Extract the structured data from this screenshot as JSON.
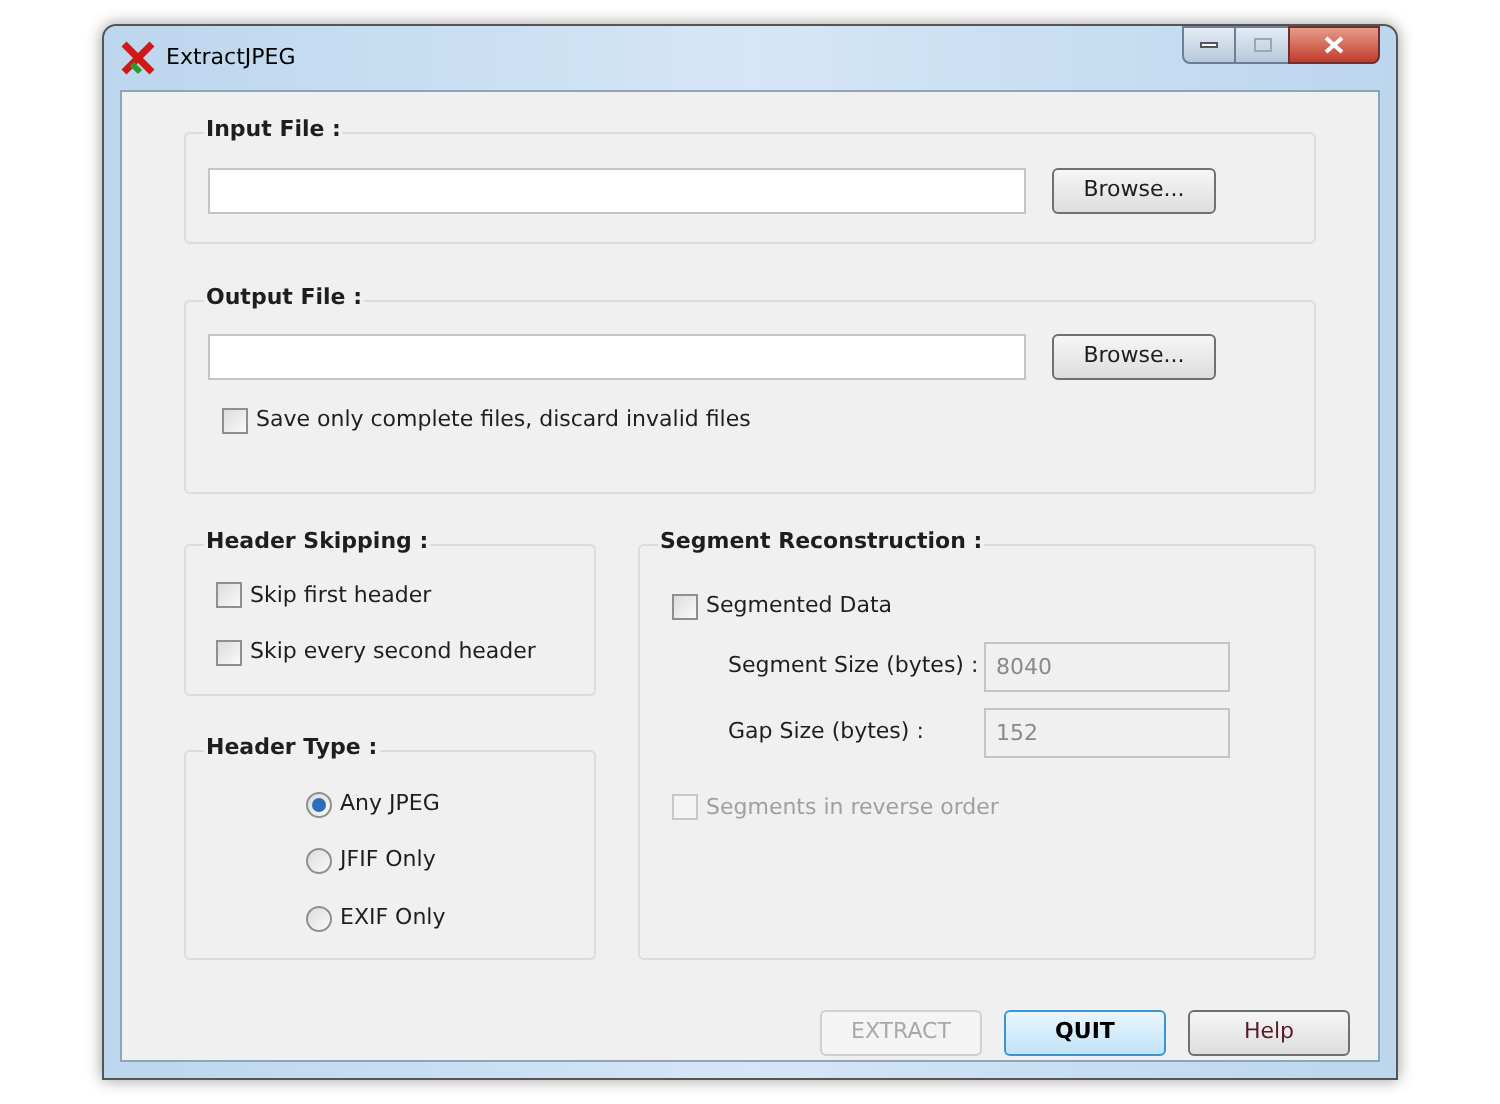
{
  "window": {
    "title": "ExtractJPEG"
  },
  "input_file": {
    "label": "Input File :",
    "browse": "Browse..."
  },
  "output_file": {
    "label": "Output File :",
    "browse": "Browse...",
    "save_complete": {
      "label": "Save only complete files, discard invalid files",
      "checked": false
    }
  },
  "header_skipping": {
    "label": "Header Skipping :",
    "options": [
      {
        "label": "Skip first header",
        "checked": false
      },
      {
        "label": "Skip every second header",
        "checked": false
      }
    ]
  },
  "header_type": {
    "label": "Header Type :",
    "options": [
      {
        "label": "Any JPEG",
        "selected": true
      },
      {
        "label": "JFIF Only",
        "selected": false
      },
      {
        "label": "EXIF Only",
        "selected": false
      }
    ]
  },
  "segment_reconstruction": {
    "label": "Segment Reconstruction :",
    "segmented": {
      "label": "Segmented Data",
      "checked": false
    },
    "fields": [
      {
        "label": "Segment Size (bytes) :",
        "value": "8040",
        "disabled": true
      },
      {
        "label": "Gap Size (bytes) :",
        "value": "152",
        "disabled": true
      }
    ],
    "reverse": {
      "label": "Segments in reverse order",
      "checked": false,
      "disabled": true
    }
  },
  "buttons": [
    {
      "label": "EXTRACT",
      "disabled": true,
      "default": false
    },
    {
      "label": "QUIT",
      "disabled": false,
      "default": true
    },
    {
      "label": "Help",
      "disabled": false,
      "default": false
    }
  ]
}
